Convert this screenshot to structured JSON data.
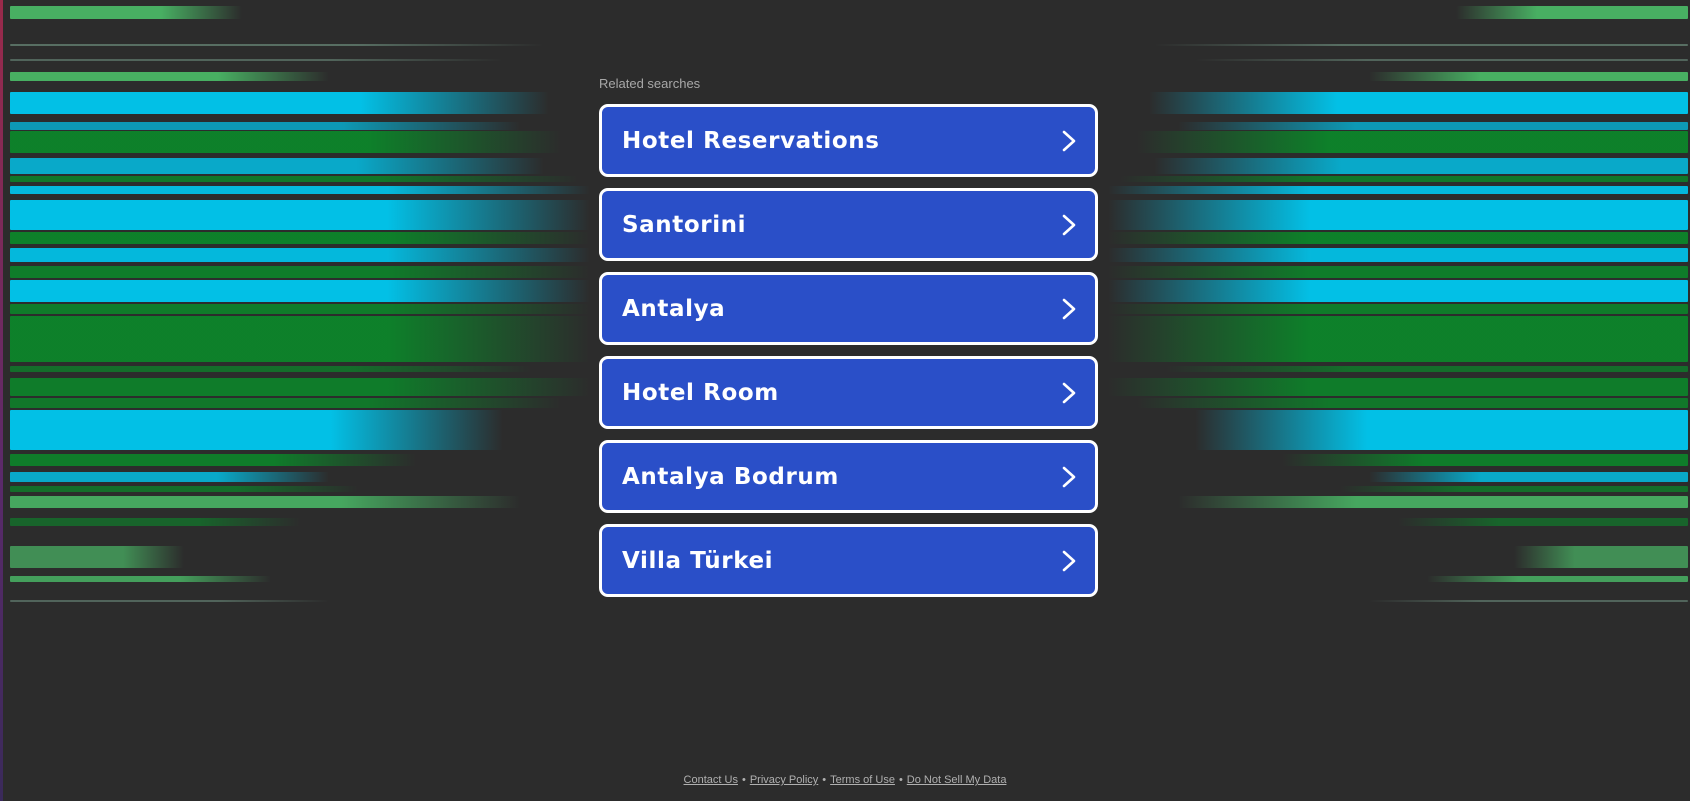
{
  "colors": {
    "page_bg": "#2c2c2c",
    "button_bg": "#2a4fc8",
    "button_border": "#ffffff",
    "button_text": "#ffffff",
    "stripe_cyan": "#00c8f0",
    "stripe_green": "#0a8a2a",
    "stripe_light_green": "#4fd070"
  },
  "related_searches": {
    "title": "Related searches",
    "items": [
      {
        "label": "Hotel Reservations",
        "icon": "chevron-right-icon"
      },
      {
        "label": "Santorini",
        "icon": "chevron-right-icon"
      },
      {
        "label": "Antalya",
        "icon": "chevron-right-icon"
      },
      {
        "label": "Hotel Room",
        "icon": "chevron-right-icon"
      },
      {
        "label": "Antalya Bodrum",
        "icon": "chevron-right-icon"
      },
      {
        "label": "Villa Türkei",
        "icon": "chevron-right-icon"
      }
    ]
  },
  "footer": {
    "links": [
      "Contact Us",
      "Privacy Policy",
      "Terms of Use",
      "Do Not Sell My Data"
    ],
    "separator": "•"
  }
}
